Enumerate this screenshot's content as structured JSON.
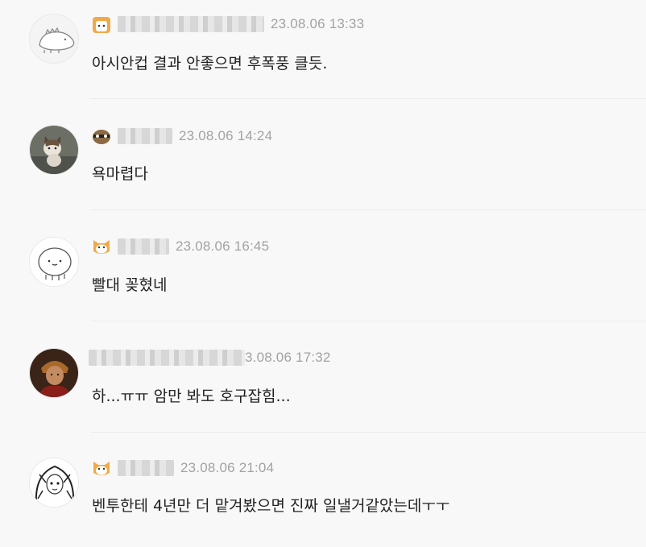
{
  "comments": [
    {
      "time": "23.08.06 13:33",
      "text": "아시안컵 결과 안좋으면 후폭풍 클듯."
    },
    {
      "time": "23.08.06 14:24",
      "text": "욕마렵다"
    },
    {
      "time": "23.08.06 16:45",
      "text": "빨대 꽂혔네"
    },
    {
      "time": "3.08.06 17:32",
      "text": "하...ㅠㅠ 암만 봐도 호구잡힘..."
    },
    {
      "time": "23.08.06 21:04",
      "text": "벤투한테 4년만 더 맡겨봤으면 진짜 일낼거같았는데ㅜㅜ"
    }
  ],
  "colors": {
    "background": "#f8f8f8",
    "text": "#222222",
    "time": "#a2a2a2",
    "divider": "#ececec"
  },
  "icons": [
    "dinosaur-avatar-icon",
    "cat-avatar-icon",
    "smiley-avatar-icon",
    "warrior-avatar-icon",
    "anime-girl-avatar-icon",
    "level-badge-icon"
  ]
}
